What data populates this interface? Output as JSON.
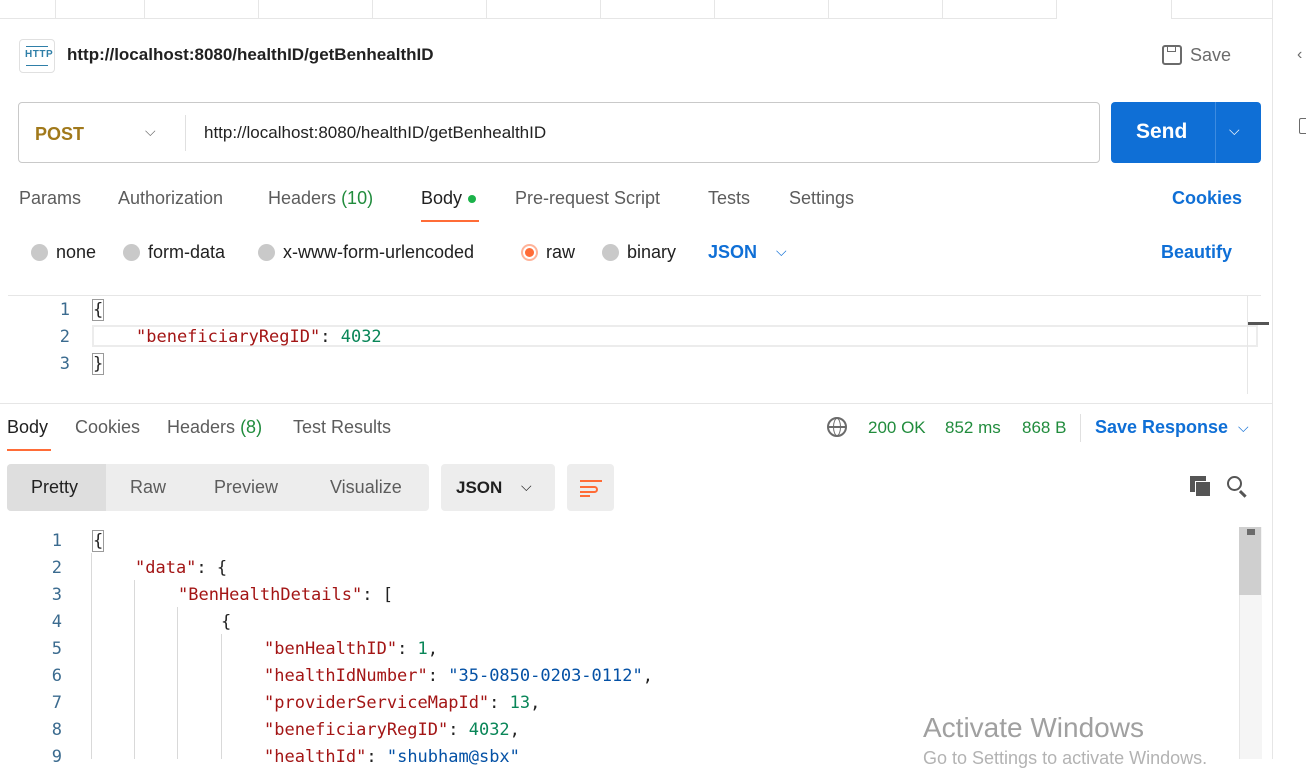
{
  "request": {
    "title": "http://localhost:8080/healthID/getBenhealthID",
    "save_label": "Save",
    "method": "POST",
    "url": "http://localhost:8080/healthID/getBenhealthID",
    "send_label": "Send"
  },
  "request_tabs": {
    "params": "Params",
    "authorization": "Authorization",
    "headers": "Headers",
    "headers_count": "(10)",
    "body": "Body",
    "pre_request": "Pre-request Script",
    "tests": "Tests",
    "settings": "Settings",
    "cookies": "Cookies"
  },
  "body_types": {
    "none": "none",
    "form_data": "form-data",
    "urlencoded": "x-www-form-urlencoded",
    "raw": "raw",
    "binary": "binary",
    "selected_format": "JSON",
    "beautify": "Beautify"
  },
  "request_body": {
    "line_numbers": [
      "1",
      "2",
      "3"
    ],
    "open_brace": "{",
    "key": "\"beneficiaryRegID\"",
    "colon": ": ",
    "value": "4032",
    "close_brace": "}"
  },
  "response_tabs": {
    "body": "Body",
    "cookies": "Cookies",
    "headers": "Headers",
    "headers_count": "(8)",
    "test_results": "Test Results"
  },
  "response_status": {
    "status": "200 OK",
    "time": "852 ms",
    "size": "868 B",
    "save_response": "Save Response"
  },
  "response_view": {
    "pretty": "Pretty",
    "raw": "Raw",
    "preview": "Preview",
    "visualize": "Visualize",
    "format": "JSON"
  },
  "response_body": {
    "line_numbers": [
      "1",
      "2",
      "3",
      "4",
      "5",
      "6",
      "7",
      "8",
      "9"
    ],
    "l1": "{",
    "l2_key": "\"data\"",
    "l2_rest": ": {",
    "l3_key": "\"BenHealthDetails\"",
    "l3_rest": ": [",
    "l4": "{",
    "l5_key": "\"benHealthID\"",
    "l5_val": "1",
    "l6_key": "\"healthIdNumber\"",
    "l6_val": "\"35-0850-0203-0112\"",
    "l7_key": "\"providerServiceMapId\"",
    "l7_val": "13",
    "l8_key": "\"beneficiaryRegID\"",
    "l8_val": "4032",
    "l9_key": "\"healthId\"",
    "l9_val": "\"shubham@sbx\""
  },
  "watermark": {
    "title": "Activate Windows",
    "subtitle": "Go to Settings to activate Windows."
  },
  "icons": {
    "http": "http-request-icon",
    "save": "floppy-disk-icon",
    "globe": "globe-icon",
    "copy": "copy-icon",
    "search": "search-icon",
    "wrap": "word-wrap-icon"
  },
  "colors": {
    "send": "#0f6fd6",
    "method": "#a1791b",
    "status_ok": "#218c3d",
    "accent": "#ff6c37"
  }
}
